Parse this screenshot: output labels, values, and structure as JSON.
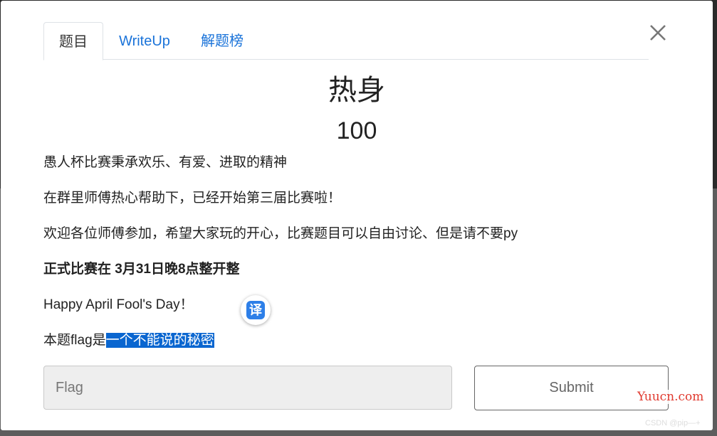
{
  "tabs": [
    {
      "label": "题目"
    },
    {
      "label": "WriteUp"
    },
    {
      "label": "解题榜"
    }
  ],
  "challenge": {
    "title": "热身",
    "points": "100"
  },
  "description": [
    "愚人杯比赛秉承欢乐、有爱、进取的精神",
    "在群里师傅热心帮助下，已经开始第三届比赛啦！",
    "欢迎各位师傅参加，希望大家玩的开心，比赛题目可以自由讨论、但是请不要py",
    "正式比赛在 3月31日晚8点整开整",
    "Happy April Fool's Day！"
  ],
  "flag_line": {
    "prefix": "本题flag是",
    "highlighted": "一个不能说的秘密"
  },
  "form": {
    "flag_placeholder": "Flag",
    "submit_label": "Submit"
  },
  "translate_button": {
    "label": "译"
  },
  "watermark": {
    "text": "Yuucn.com"
  },
  "credit": {
    "text": "CSDN @pip—+"
  },
  "icons": {
    "close": "close-icon"
  }
}
